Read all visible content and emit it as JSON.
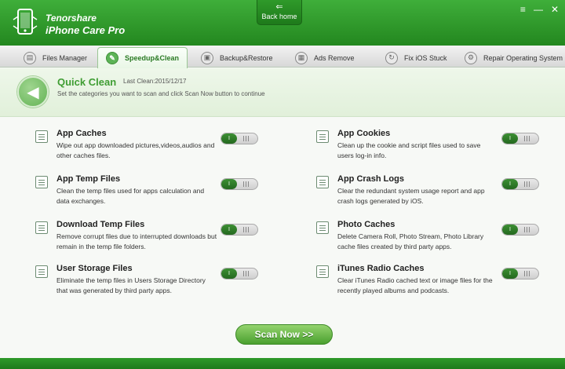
{
  "app": {
    "brand": "Tenorshare",
    "product": "iPhone Care Pro",
    "back_home": "Back home"
  },
  "window_controls": [
    "≡",
    "—",
    "✕"
  ],
  "tabs": [
    {
      "label": "Files Manager",
      "icon": "files-manager-icon",
      "active": false
    },
    {
      "label": "Speedup&Clean",
      "icon": "speedup-clean-icon",
      "active": true
    },
    {
      "label": "Backup&Restore",
      "icon": "backup-restore-icon",
      "active": false
    },
    {
      "label": "Ads Remove",
      "icon": "ads-remove-icon",
      "active": false
    },
    {
      "label": "Fix iOS Stuck",
      "icon": "fix-ios-stuck-icon",
      "active": false
    },
    {
      "label": "Repair Operating System",
      "icon": "repair-os-icon",
      "active": false
    }
  ],
  "header": {
    "title": "Quick Clean",
    "last_clean": "Last Clean:2015/12/17",
    "description": "Set the categories you want to scan and click Scan Now button to continue"
  },
  "items": [
    {
      "title": "App Caches",
      "desc": "Wipe out app downloaded pictures,videos,audios and other caches files.",
      "icon": "app-caches-icon",
      "enabled": true
    },
    {
      "title": "App Cookies",
      "desc": "Clean up the cookie and script files used to save users log-in info.",
      "icon": "app-cookies-icon",
      "enabled": true
    },
    {
      "title": "App Temp Files",
      "desc": "Clean the temp files used for apps calculation and data exchanges.",
      "icon": "app-temp-files-icon",
      "enabled": true
    },
    {
      "title": "App Crash Logs",
      "desc": "Clear the redundant system usage report and app crash logs generated by iOS.",
      "icon": "app-crash-logs-icon",
      "enabled": true
    },
    {
      "title": "Download Temp Files",
      "desc": "Remove corrupt files due to interrupted downloads but remain in the temp file folders.",
      "icon": "download-temp-files-icon",
      "enabled": true
    },
    {
      "title": "Photo Caches",
      "desc": "Delete Camera Roll, Photo Stream, Photo Library cache files created by third party apps.",
      "icon": "photo-caches-icon",
      "enabled": true
    },
    {
      "title": "User Storage Files",
      "desc": "Eliminate the temp files in Users Storage Directory that was generated by third party apps.",
      "icon": "user-storage-files-icon",
      "enabled": true
    },
    {
      "title": "iTunes Radio Caches",
      "desc": "Clear iTunes Radio cached text or image files for the recently played albums and podcasts.",
      "icon": "itunes-radio-caches-icon",
      "enabled": true
    }
  ],
  "toggle_on_label": "I",
  "scan_button": "Scan Now >>",
  "colors": {
    "brand_green": "#2f9a2a",
    "accent_green": "#3f9d33"
  }
}
